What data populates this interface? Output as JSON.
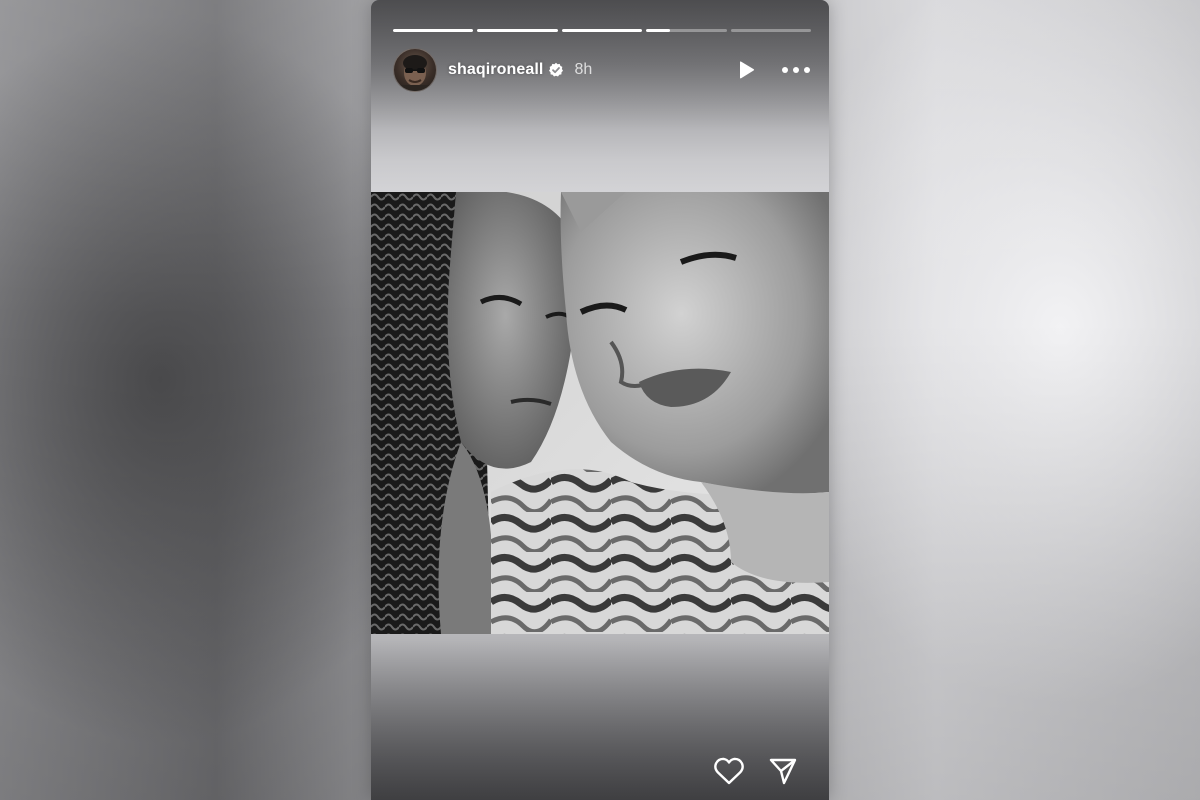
{
  "story": {
    "username": "shaqironeall",
    "verified": true,
    "time_ago": "8h",
    "progress": [
      1,
      1,
      1,
      0.3,
      0
    ],
    "icons": {
      "avatar": "user-avatar",
      "verified": "verified-badge-icon",
      "play": "play-icon",
      "more": "more-options-icon",
      "like": "heart-icon",
      "share": "send-icon"
    },
    "photo": {
      "kind": "black-and-white selfie"
    }
  }
}
